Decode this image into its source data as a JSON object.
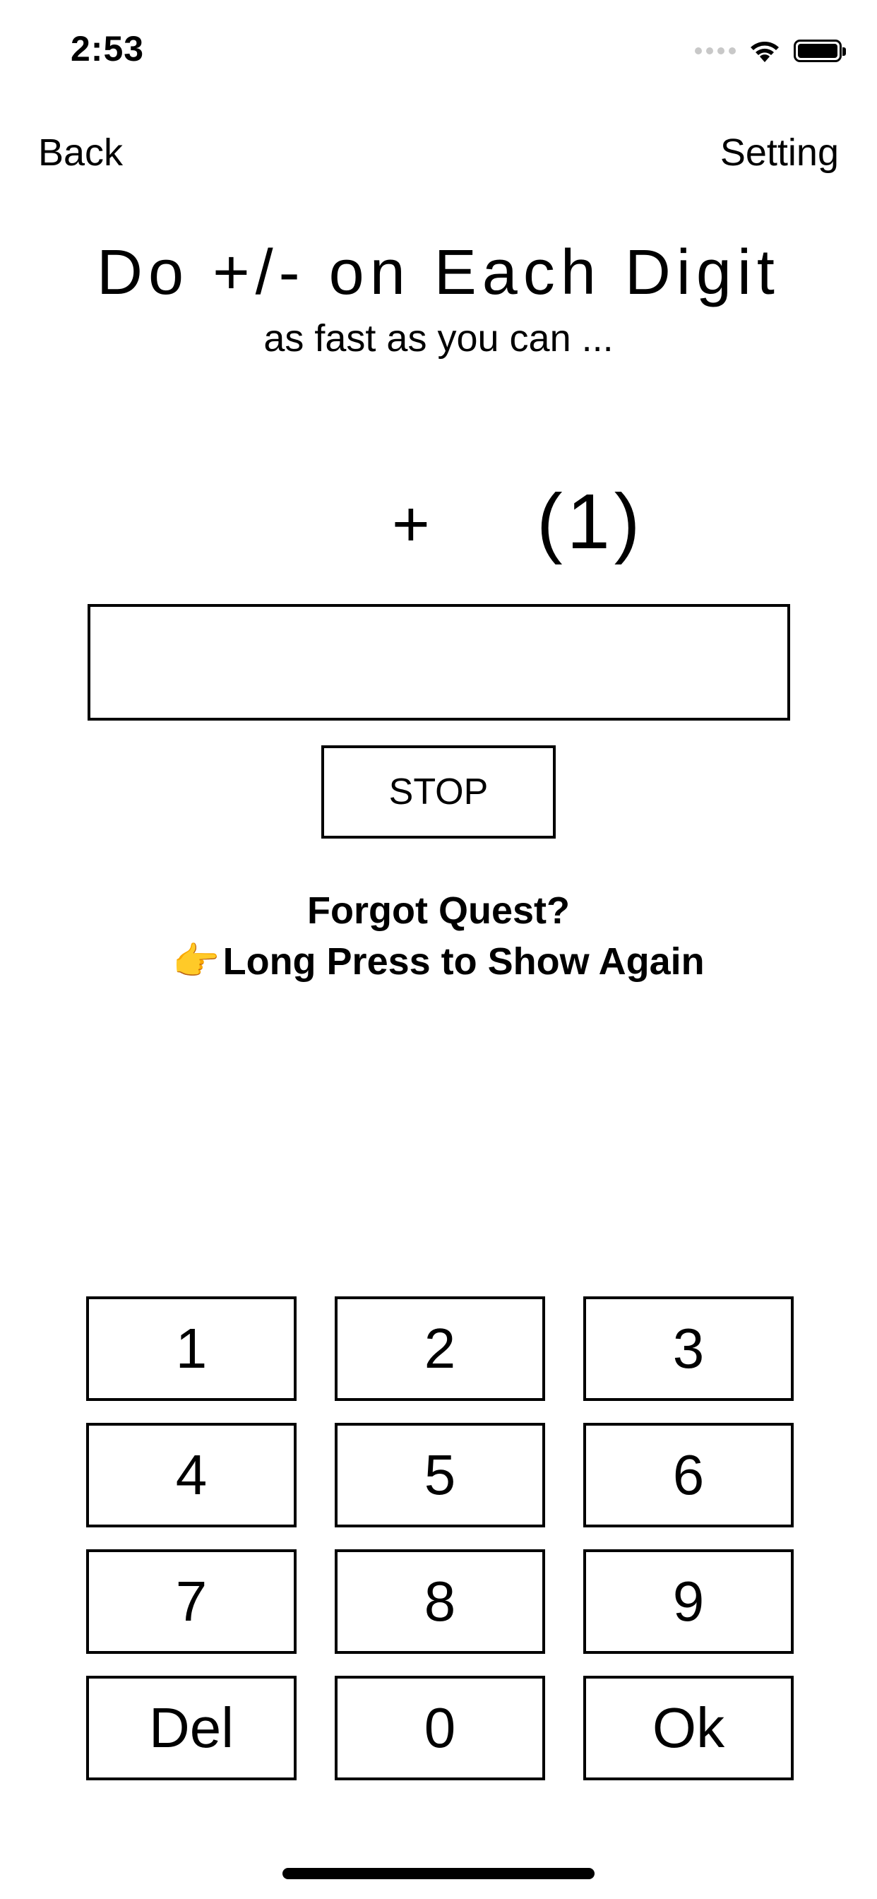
{
  "status_bar": {
    "time": "2:53",
    "icons": [
      "signal-icon",
      "wifi-icon",
      "battery-icon"
    ]
  },
  "nav": {
    "back_label": "Back",
    "setting_label": "Setting"
  },
  "header": {
    "title": "Do +/- on Each Digit",
    "subtitle": "as fast as you can ..."
  },
  "quest": {
    "operator": "+",
    "number": "(1)"
  },
  "answer": {
    "value": ""
  },
  "stop_label": "STOP",
  "hint": {
    "line1": "Forgot Quest?",
    "pointer": "👉",
    "line2": "Long Press to Show Again"
  },
  "keypad": {
    "keys": [
      "1",
      "2",
      "3",
      "4",
      "5",
      "6",
      "7",
      "8",
      "9",
      "Del",
      "0",
      "Ok"
    ]
  }
}
